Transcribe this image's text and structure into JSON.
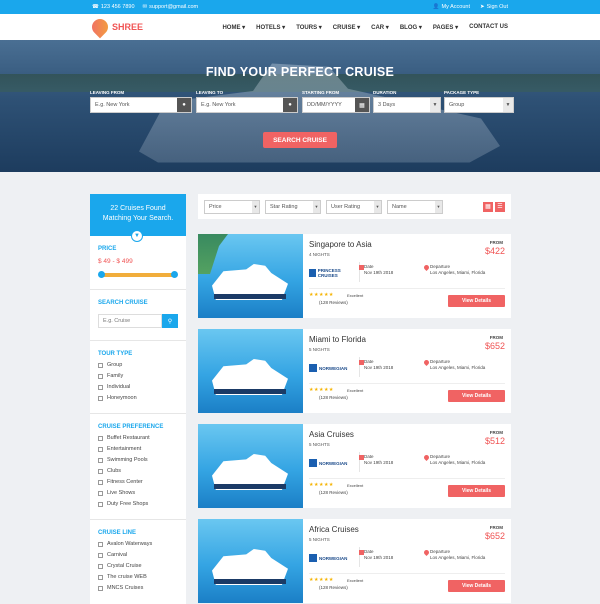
{
  "topbar": {
    "phone": "123 456 7890",
    "email": "support@gmail.com",
    "account": "My Account",
    "signout": "Sign Out"
  },
  "brand": {
    "name": "SHREE"
  },
  "nav": [
    "HOME",
    "HOTELS",
    "TOURS",
    "CRUISE",
    "CAR",
    "BLOG",
    "PAGES",
    "CONTACT US"
  ],
  "hero": {
    "title": "FIND YOUR PERFECT CRUISE",
    "search_button": "SEARCH CRUISE"
  },
  "search": {
    "leaving_from": {
      "label": "LEAVING FROM",
      "placeholder": "E.g. New York"
    },
    "leaving_to": {
      "label": "LEAVING TO",
      "placeholder": "E.g. New York"
    },
    "starting_from": {
      "label": "STARTING FROM",
      "placeholder": "DD/MM/YYYY"
    },
    "duration": {
      "label": "DURATION",
      "value": "3 Days"
    },
    "package_type": {
      "label": "PACKAGE TYPE",
      "value": "Group"
    }
  },
  "sidebar": {
    "found_line1": "22 Cruises Found",
    "found_line2": "Matching Your Search.",
    "price_title": "PRICE",
    "price_range": "$ 49 - $ 499",
    "search_title": "SEARCH CRUISE",
    "search_placeholder": "E.g. Cruise",
    "tour_type_title": "TOUR TYPE",
    "tour_types": [
      "Group",
      "Family",
      "Individual",
      "Honeymoon"
    ],
    "pref_title": "CRUISE PREFERENCE",
    "preferences": [
      "Buffet Restaurant",
      "Entertainment",
      "Swimming Pools",
      "Clubs",
      "Fitness Center",
      "Live Shows",
      "Duty Free Shops"
    ],
    "line_title": "CRUISE LINE",
    "lines": [
      "Avalon Waterways",
      "Carnival",
      "Crystal Cruise",
      "The cruise WEB",
      "MNCS Cruises"
    ]
  },
  "filters": {
    "price": "Price",
    "star": "Star Rating",
    "user": "User Rating",
    "name": "Name"
  },
  "cards": [
    {
      "title": "Singapore to Asia",
      "nights": "4 NIGHTS",
      "from": "FROM",
      "price": "$422",
      "brand": "PRINCESS CRUISES",
      "date_label": "Date",
      "date": "Nov 19th 2018",
      "dep_label": "Departure",
      "dep": "Los Angeles, Miami, Florida",
      "rating": "Excellent",
      "reviews": "(128 Reviews)",
      "button": "View Details"
    },
    {
      "title": "Miami to Florida",
      "nights": "5 NIGHTS",
      "from": "FROM",
      "price": "$652",
      "brand": "NORWEGIAN",
      "date_label": "Date",
      "date": "Nov 19th 2018",
      "dep_label": "Departure",
      "dep": "Los Angeles, Miami, Florida",
      "rating": "Excellent",
      "reviews": "(128 Reviews)",
      "button": "View Details"
    },
    {
      "title": "Asia Cruises",
      "nights": "5 NIGHTS",
      "from": "FROM",
      "price": "$512",
      "brand": "NORWEGIAN",
      "date_label": "Date",
      "date": "Nov 19th 2018",
      "dep_label": "Departure",
      "dep": "Los Angeles, Miami, Florida",
      "rating": "Excellent",
      "reviews": "(128 Reviews)",
      "button": "View Details"
    },
    {
      "title": "Africa Cruises",
      "nights": "5 NIGHTS",
      "from": "FROM",
      "price": "$652",
      "brand": "NORWEGIAN",
      "date_label": "Date",
      "date": "Nov 19th 2018",
      "dep_label": "Departure",
      "dep": "Los Angeles, Miami, Florida",
      "rating": "Excellent",
      "reviews": "(128 Reviews)",
      "button": "View Details"
    }
  ]
}
